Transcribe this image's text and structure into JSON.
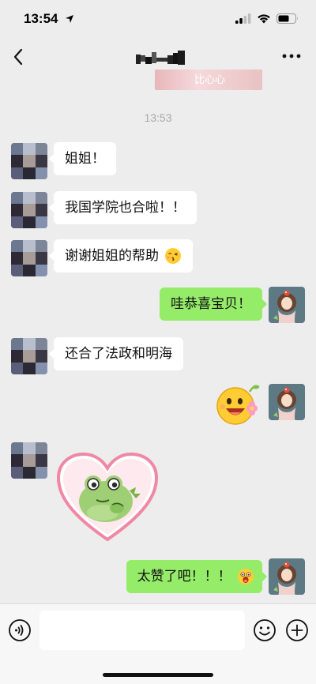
{
  "status_bar": {
    "time": "13:54"
  },
  "previous_sticker_text": "比心心",
  "timestamp": "13:53",
  "messages": [
    {
      "side": "left",
      "text": "姐姐！"
    },
    {
      "side": "left",
      "text": "我国学院也合啦！！"
    },
    {
      "side": "left",
      "text": "谢谢姐姐的帮助"
    },
    {
      "side": "right",
      "text": "哇恭喜宝贝！"
    },
    {
      "side": "left",
      "text": "还合了法政和明海"
    },
    {
      "side": "right",
      "text": "太赞了吧！！！"
    }
  ],
  "icons": {
    "kiss": "kissing-emoji-icon",
    "happy_flower": "happy-flower-sticker",
    "frog_heart": "frog-heart-sticker",
    "shock": "shocked-emoji-icon"
  },
  "colors": {
    "background": "#ededed",
    "bubble_self": "#95ec69",
    "bubble_other": "#ffffff",
    "timestamp": "#a8a8a8"
  },
  "input": {
    "value": "",
    "placeholder": ""
  }
}
